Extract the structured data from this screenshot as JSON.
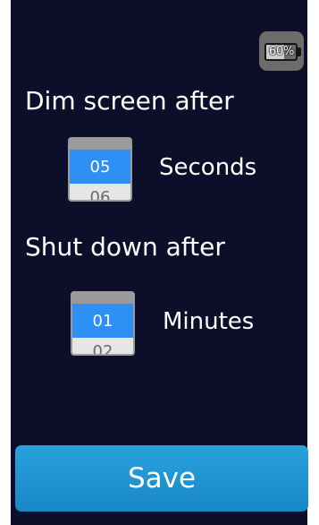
{
  "status": {
    "battery_text": "60%",
    "battery_level": 0.6
  },
  "dim": {
    "label": "Dim screen after",
    "value": "05",
    "next_value": "06",
    "unit": "Seconds"
  },
  "shutdown": {
    "label": "Shut down after",
    "value": "01",
    "next_value": "02",
    "unit": "Minutes"
  },
  "actions": {
    "save_label": "Save"
  },
  "colors": {
    "background": "#0d0f2a",
    "picker_selected": "#2e8ff5",
    "save_button": "#1f94d2",
    "text": "#ffffff"
  }
}
